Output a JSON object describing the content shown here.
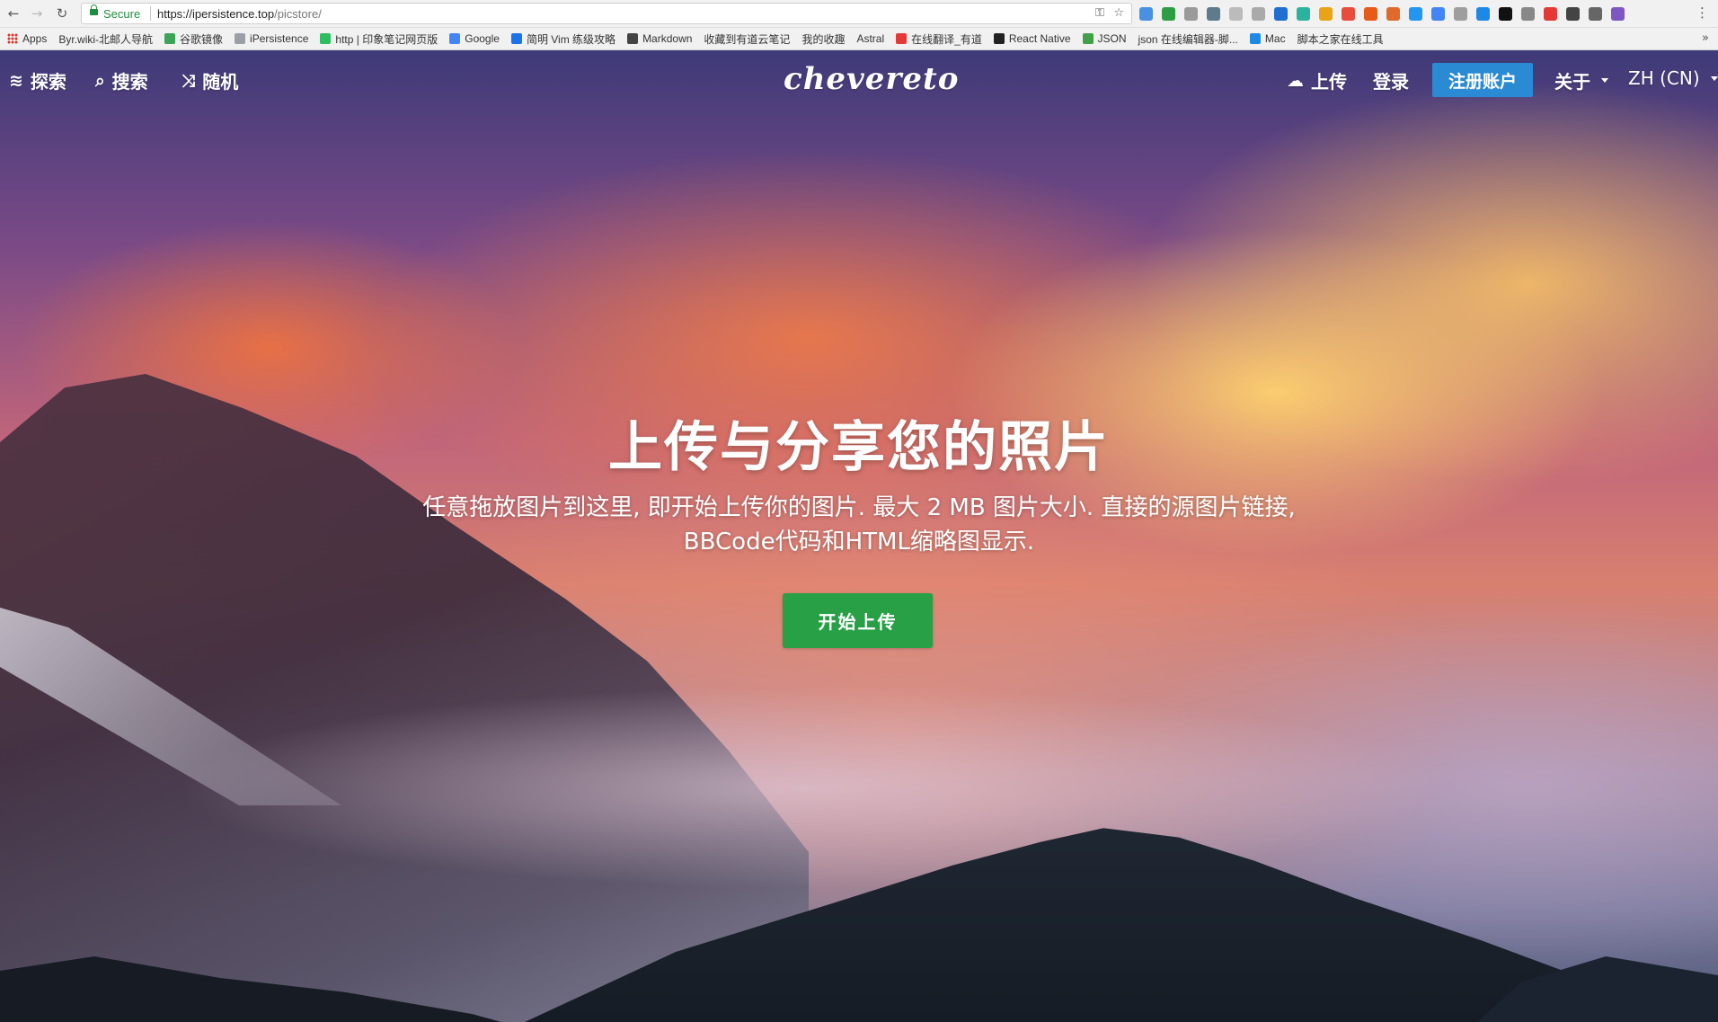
{
  "browser": {
    "secure_label": "Secure",
    "url_host": "https://ipersistence.top",
    "url_path": "/picstore/",
    "nav": {
      "back": "←",
      "forward": "→",
      "reload": "↻"
    },
    "omnibox_icons": {
      "key": "⚿",
      "star": "☆"
    },
    "extension_colors": [
      "#4a90e2",
      "#2e9e44",
      "#9a9a9a",
      "#5d7b8a",
      "#bbbbbb",
      "#aaaaaa",
      "#1f6fd1",
      "#2bb3a0",
      "#e8a317",
      "#e74c3c",
      "#e85a18",
      "#e06a2b",
      "#2196f3",
      "#4285f4",
      "#9e9e9e",
      "#1e88e5",
      "#111111",
      "#888888",
      "#e53935",
      "#444444",
      "#666666",
      "#7e57c2"
    ],
    "menu_label": "⋮"
  },
  "bookmarks": [
    {
      "label": "Apps",
      "icon": "apps-grid-icon"
    },
    {
      "label": "Byr.wiki-北邮人导航",
      "icon": "page-icon"
    },
    {
      "label": "谷歌镜像",
      "icon": "leaf-icon",
      "color": "#3aa655"
    },
    {
      "label": "iPersistence",
      "icon": "folder-icon",
      "color": "#9aa0a6"
    },
    {
      "label": "http | 印象笔记网页版",
      "icon": "evernote-icon",
      "color": "#2dbe60"
    },
    {
      "label": "Google",
      "icon": "google-icon",
      "color": "#4285f4"
    },
    {
      "label": "简明 Vim 练级攻略",
      "icon": "coolshell-icon",
      "color": "#1a73e8"
    },
    {
      "label": "Markdown",
      "icon": "book-icon",
      "color": "#444444"
    },
    {
      "label": "收藏到有道云笔记",
      "icon": "page-icon"
    },
    {
      "label": "我的收趣",
      "icon": "page-icon"
    },
    {
      "label": "Astral",
      "icon": "page-icon"
    },
    {
      "label": "在线翻译_有道",
      "icon": "youdao-icon",
      "color": "#e53935"
    },
    {
      "label": "React Native",
      "icon": "react-icon",
      "color": "#222222"
    },
    {
      "label": "JSON",
      "icon": "json-icon",
      "color": "#43a047"
    },
    {
      "label": "json 在线编辑器-脚...",
      "icon": "page-icon"
    },
    {
      "label": "Mac",
      "icon": "mac-icon",
      "color": "#1e88e5"
    },
    {
      "label": "脚本之家在线工具",
      "icon": "page-icon"
    }
  ],
  "bookmarks_more": "»",
  "site": {
    "nav_left": [
      {
        "label": "探索",
        "icon": "layers-icon",
        "glyph": "≋"
      },
      {
        "label": "搜索",
        "icon": "search-icon",
        "glyph": "⌕"
      },
      {
        "label": "随机",
        "icon": "shuffle-icon",
        "glyph": "⤨"
      }
    ],
    "logo": "chevereto",
    "upload": {
      "label": "上传",
      "icon": "cloud-upload-icon",
      "glyph": "☁"
    },
    "login": "登录",
    "signup": "注册账户",
    "about": "关于",
    "language": "ZH (CN)",
    "accent_color": "#2a8ad3"
  },
  "hero": {
    "title": "上传与分享您的照片",
    "description": "任意拖放图片到这里, 即开始上传你的图片. 最大 2 MB 图片大小. 直接的源图片链接, BBCode代码和HTML缩略图显示.",
    "button": "开始上传",
    "button_color": "#27a046"
  }
}
